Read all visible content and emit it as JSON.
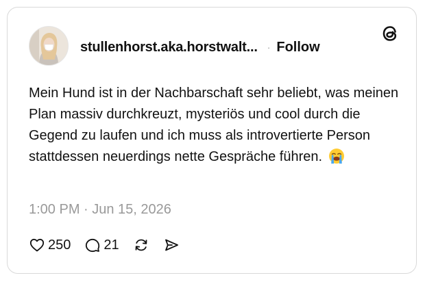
{
  "post": {
    "username": "stullenhorst.aka.horstwalt...",
    "separator": "·",
    "follow_label": "Follow",
    "text": "Mein Hund ist in der Nachbarschaft sehr beliebt, was meinen Plan massiv durchkreuzt, mysteriös und cool durch die Gegend zu laufen und ich muss als introvertierte Person stattdessen neuerdings nette Gespräche führen.",
    "emoji": "loudly-crying-face",
    "timestamp": "1:00 PM · Jun 15, 2026",
    "likes": "250",
    "replies": "21"
  },
  "icons": {
    "logo": "threads-logo-icon",
    "like": "heart-icon",
    "reply": "comment-icon",
    "repost": "repost-icon",
    "share": "send-icon"
  }
}
